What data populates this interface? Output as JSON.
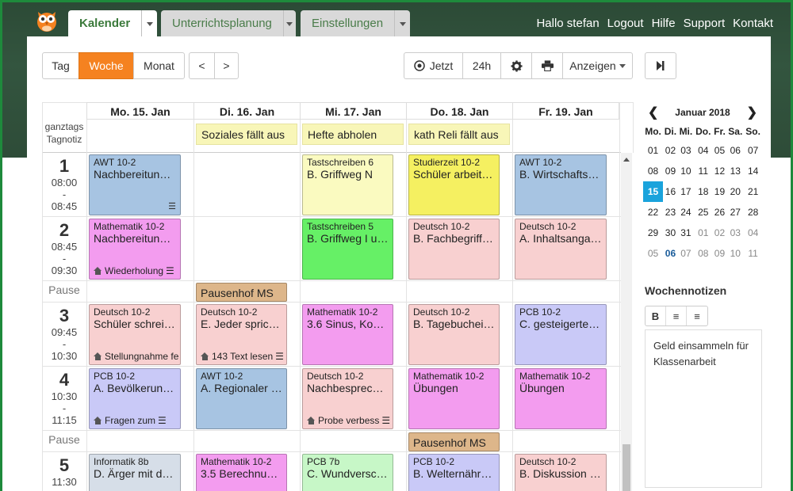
{
  "tabs": [
    {
      "label": "Kalender"
    },
    {
      "label": "Unterrichtsplanung"
    },
    {
      "label": "Einstellungen"
    }
  ],
  "toplinks": [
    "Hallo stefan",
    "Logout",
    "Hilfe",
    "Support",
    "Kontakt"
  ],
  "toolbar": {
    "tag": "Tag",
    "woche": "Woche",
    "monat": "Monat",
    "prev": "<",
    "next": ">",
    "jetzt": "Jetzt",
    "h24": "24h",
    "anzeigen": "Anzeigen"
  },
  "days": [
    "Mo. 15. Jan",
    "Di. 16. Jan",
    "Mi. 17. Jan",
    "Do. 18. Jan",
    "Fr. 19. Jan"
  ],
  "ganztags": {
    "l1": "ganztags",
    "l2": "Tagnotiz"
  },
  "day_notes": [
    "Soziales fällt aus",
    "Hefte abholen",
    "kath Reli fällt aus"
  ],
  "rows": [
    {
      "num": "1",
      "start": "08:00",
      "sep": "-",
      "end": "08:45"
    },
    {
      "num": "2",
      "start": "08:45",
      "sep": "-",
      "end": "09:30"
    },
    {
      "num": "3",
      "start": "09:45",
      "sep": "-",
      "end": "10:30"
    },
    {
      "num": "4",
      "start": "10:30",
      "sep": "-",
      "end": "11:15"
    },
    {
      "num": "5",
      "start": "11:30",
      "sep": "",
      "end": ""
    }
  ],
  "pause_label": "Pause",
  "pausenhof": "Pausenhof MS",
  "events": [
    {
      "course": "AWT 10-2",
      "desc": "Nachbereitun…",
      "hw": ""
    },
    {
      "course": "Tastschreiben 6",
      "desc": "B. Griffweg N",
      "hw": ""
    },
    {
      "course": "Studierzeit 10-2",
      "desc": "Schüler arbeit…",
      "hw": ""
    },
    {
      "course": "AWT 10-2",
      "desc": "B. Wirtschafts…",
      "hw": ""
    },
    {
      "course": "Mathematik 10-2",
      "desc": "Nachbereitun…",
      "hw": "Wiederholung"
    },
    {
      "course": "Tastschreiben 5",
      "desc": "B. Griffweg I u…",
      "hw": ""
    },
    {
      "course": "Deutsch 10-2",
      "desc": "B. Fachbegriff…",
      "hw": ""
    },
    {
      "course": "Deutsch 10-2",
      "desc": "A. Inhaltsanga…",
      "hw": ""
    },
    {
      "course": "Deutsch 10-2",
      "desc": "Schüler schrei…",
      "hw": "Stellungnahme fe"
    },
    {
      "course": "Deutsch 10-2",
      "desc": "E. Jeder sprich…",
      "hw": "143 Text lesen"
    },
    {
      "course": "Mathematik 10-2",
      "desc": "3.6 Sinus, Ko…",
      "hw": ""
    },
    {
      "course": "Deutsch 10-2",
      "desc": "B. Tagebuchei…",
      "hw": ""
    },
    {
      "course": "PCB 10-2",
      "desc": "C. gesteigerte…",
      "hw": ""
    },
    {
      "course": "PCB 10-2",
      "desc": "A. Bevölkerun…",
      "hw": "Fragen zum"
    },
    {
      "course": "AWT 10-2",
      "desc": "A. Regionaler …",
      "hw": ""
    },
    {
      "course": "Deutsch 10-2",
      "desc": "Nachbesprec…",
      "hw": "Probe verbess"
    },
    {
      "course": "Mathematik 10-2",
      "desc": "Übungen",
      "hw": ""
    },
    {
      "course": "Mathematik 10-2",
      "desc": "Übungen",
      "hw": ""
    },
    {
      "course": "Informatik 8b",
      "desc": "D. Ärger mit d…",
      "hw": ""
    },
    {
      "course": "Mathematik 10-2",
      "desc": "3.5 Berechnu…",
      "hw": ""
    },
    {
      "course": "PCB 7b",
      "desc": "C. Wundversc…",
      "hw": ""
    },
    {
      "course": "PCB 10-2",
      "desc": "B. Welternähr…",
      "hw": ""
    },
    {
      "course": "Deutsch 10-2",
      "desc": "B. Diskussion …",
      "hw": ""
    }
  ],
  "mini_calendar": {
    "month": "Januar 2018",
    "weekdays": [
      "Mo.",
      "Di.",
      "Mi.",
      "Do.",
      "Fr.",
      "Sa.",
      "So."
    ],
    "weeks": [
      [
        "01",
        "02",
        "03",
        "04",
        "05",
        "06",
        "07"
      ],
      [
        "08",
        "09",
        "10",
        "11",
        "12",
        "13",
        "14"
      ],
      [
        "15",
        "16",
        "17",
        "18",
        "19",
        "20",
        "21"
      ],
      [
        "22",
        "23",
        "24",
        "25",
        "26",
        "27",
        "28"
      ],
      [
        "29",
        "30",
        "31",
        "01",
        "02",
        "03",
        "04"
      ],
      [
        "05",
        "06",
        "07",
        "08",
        "09",
        "10",
        "11"
      ]
    ]
  },
  "weeknotes": {
    "title": "Wochennotizen",
    "text": "Geld einsammeln für Klassenarbeit"
  },
  "colors": {
    "accent": "#f58220",
    "today": "#1aa3dc",
    "brand_green": "#3b7a3b"
  }
}
